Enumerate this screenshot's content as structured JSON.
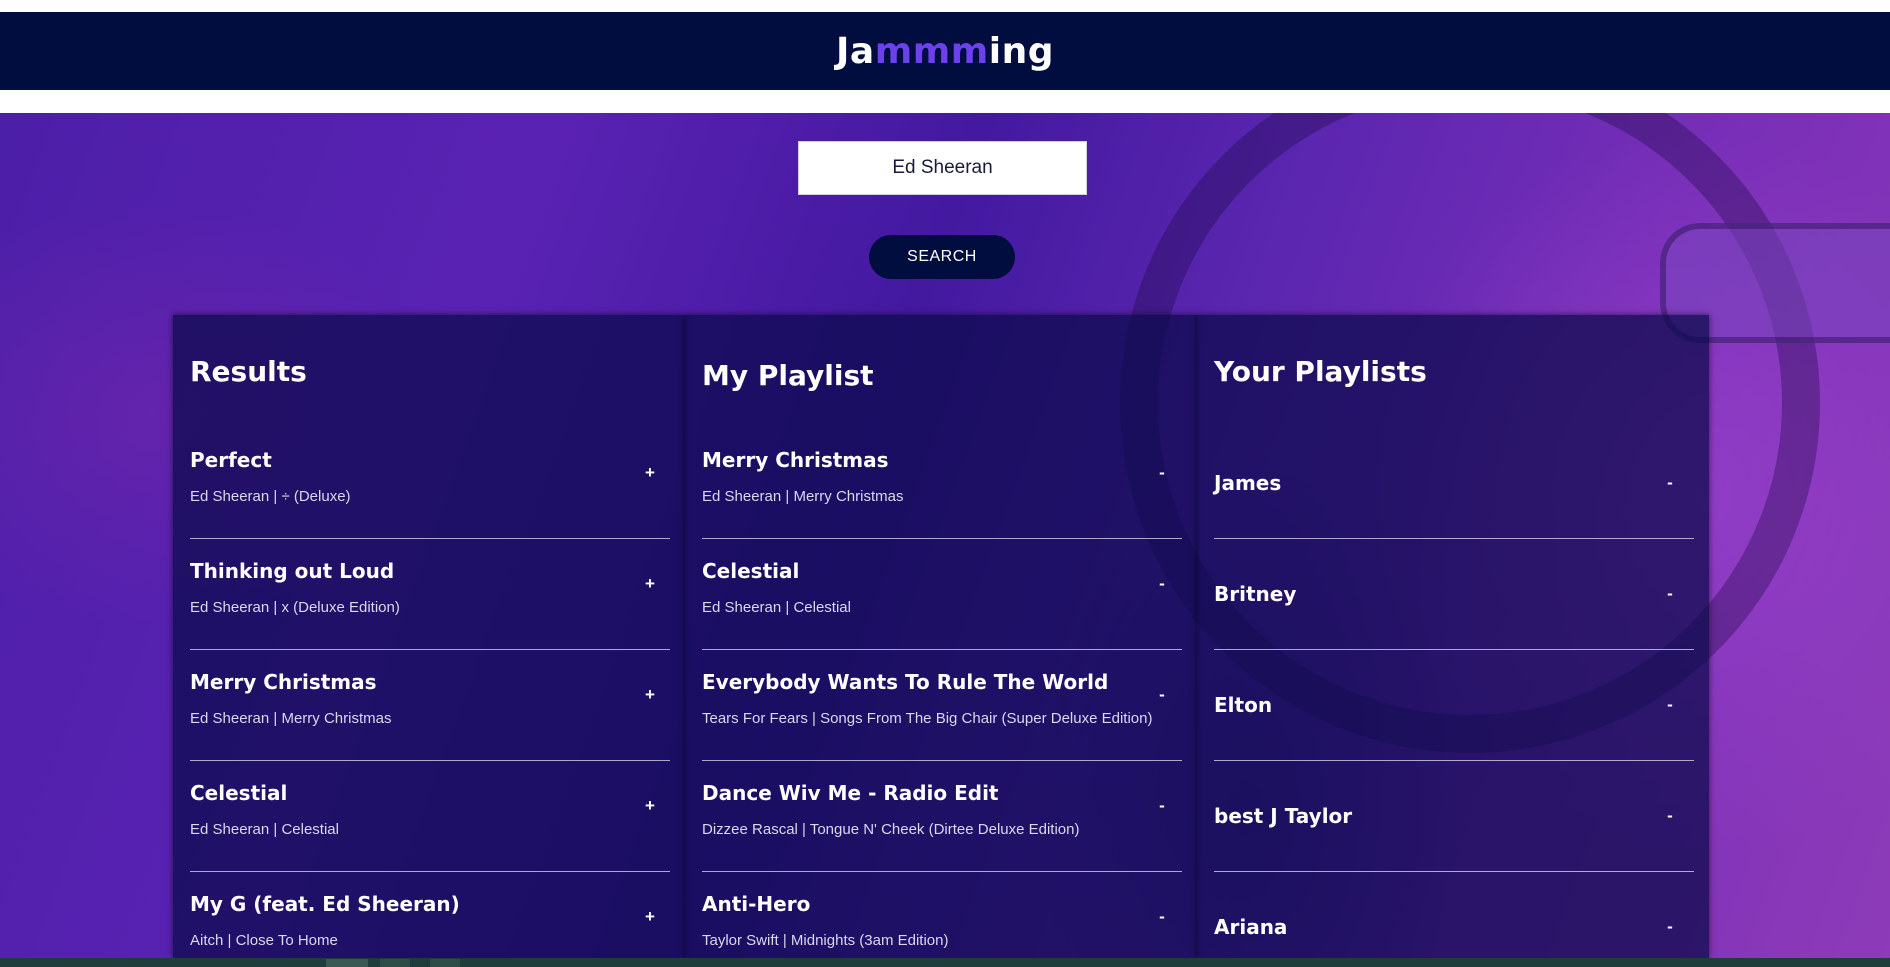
{
  "app": {
    "logo_parts": [
      "Ja",
      "mmm",
      "ing"
    ],
    "accent_color": "#6c41ec",
    "header_bg": "#010c3f"
  },
  "search": {
    "value": "Ed Sheeran",
    "button_label": "SEARCH"
  },
  "results": {
    "title": "Results",
    "action_icon": "plus-icon",
    "tracks": [
      {
        "name": "Perfect",
        "sub": "Ed Sheeran | ÷ (Deluxe)",
        "action": "+"
      },
      {
        "name": "Thinking out Loud",
        "sub": "Ed Sheeran | x (Deluxe Edition)",
        "action": "+"
      },
      {
        "name": "Merry Christmas",
        "sub": "Ed Sheeran | Merry Christmas",
        "action": "+"
      },
      {
        "name": "Celestial",
        "sub": "Ed Sheeran | Celestial",
        "action": "+"
      },
      {
        "name": "My G (feat. Ed Sheeran)",
        "sub": "Aitch | Close To Home",
        "action": "+"
      }
    ]
  },
  "my_playlist": {
    "title": "My Playlist",
    "action_icon": "minus-icon",
    "tracks": [
      {
        "name": "Merry Christmas",
        "sub": "Ed Sheeran | Merry Christmas",
        "action": "-"
      },
      {
        "name": "Celestial",
        "sub": "Ed Sheeran | Celestial",
        "action": "-"
      },
      {
        "name": "Everybody Wants To Rule The World",
        "sub": "Tears For Fears | Songs From The Big Chair (Super Deluxe Edition)",
        "action": "-"
      },
      {
        "name": "Dance Wiv Me - Radio Edit",
        "sub": "Dizzee Rascal | Tongue N' Cheek (Dirtee Deluxe Edition)",
        "action": "-"
      },
      {
        "name": "Anti-Hero",
        "sub": "Taylor Swift | Midnights (3am Edition)",
        "action": "-"
      }
    ]
  },
  "your_playlists": {
    "title": "Your Playlists",
    "action_icon": "minus-icon",
    "items": [
      {
        "name": "James",
        "action": "-"
      },
      {
        "name": "Britney",
        "action": "-"
      },
      {
        "name": "Elton",
        "action": "-"
      },
      {
        "name": "best J Taylor",
        "action": "-"
      },
      {
        "name": "Ariana",
        "action": "-"
      }
    ]
  }
}
